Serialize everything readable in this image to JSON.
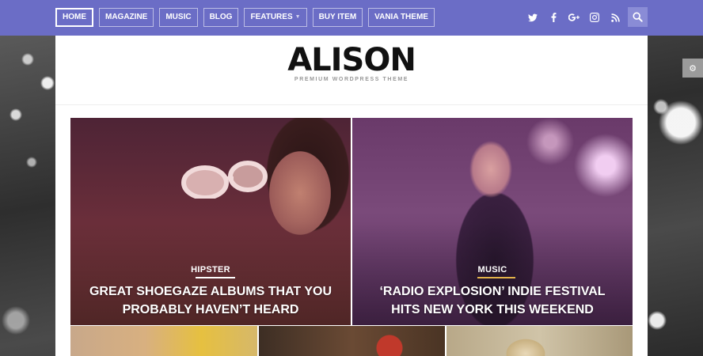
{
  "nav": {
    "items": [
      {
        "label": "HOME",
        "active": true
      },
      {
        "label": "MAGAZINE"
      },
      {
        "label": "MUSIC"
      },
      {
        "label": "BLOG"
      },
      {
        "label": "FEATURES",
        "has_dropdown": true
      },
      {
        "label": "BUY ITEM"
      },
      {
        "label": "VANIA THEME"
      }
    ],
    "socials": [
      "twitter-icon",
      "facebook-icon",
      "google-plus-icon",
      "instagram-icon",
      "rss-icon"
    ],
    "colors": {
      "bar": "#6b6dc6",
      "search": "#8a8cd6"
    }
  },
  "site": {
    "logo": "ALISON",
    "tagline": "PREMIUM WORDPRESS THEME"
  },
  "posts": [
    {
      "category": "HIPSTER",
      "title": "GREAT SHOEGAZE ALBUMS THAT YOU PROBABLY HAVEN’T HEARD"
    },
    {
      "category": "MUSIC",
      "title": "‘RADIO EXPLOSION’ INDIE FESTIVAL HITS NEW YORK THIS WEEKEND"
    }
  ],
  "social_glyphs": {
    "twitter": "t",
    "facebook": "f",
    "google_plus": "g+",
    "instagram": "◘",
    "rss": "◔"
  }
}
